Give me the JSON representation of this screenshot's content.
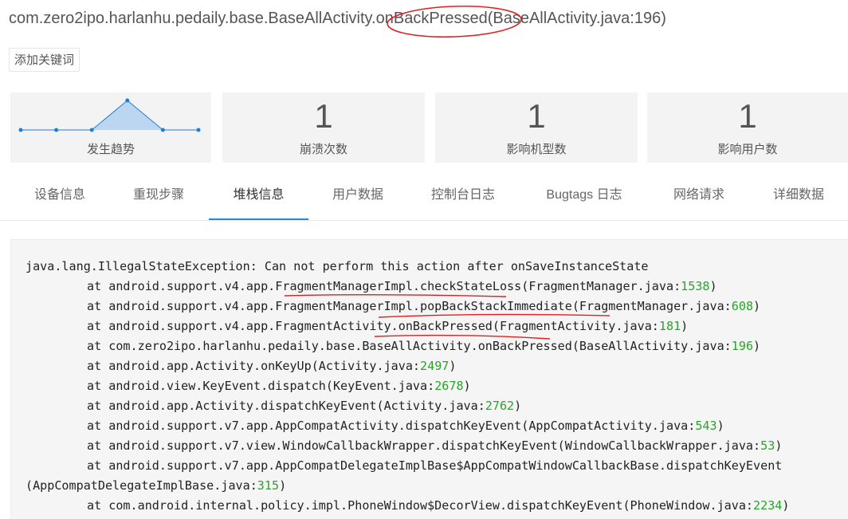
{
  "header": {
    "title": "com.zero2ipo.harlanhu.pedaily.base.BaseAllActivity.onBackPressed(BaseAllActivity.java:196)",
    "add_keyword_label": "添加关键词"
  },
  "stats": {
    "trend_label": "发生趋势",
    "trend_values": [
      0,
      0,
      0,
      1,
      0,
      0
    ],
    "crash_count": "1",
    "crash_count_label": "崩溃次数",
    "device_models": "1",
    "device_models_label": "影响机型数",
    "users": "1",
    "users_label": "影响用户数"
  },
  "tabs": [
    "设备信息",
    "重现步骤",
    "堆栈信息",
    "用户数据",
    "控制台日志",
    "Bugtags 日志",
    "网络请求",
    "详细数据"
  ],
  "active_tab": "堆栈信息",
  "stack": {
    "exception": "java.lang.IllegalStateException: Can not perform this action after onSaveInstanceState",
    "frames": [
      {
        "prefix": "at android.support.v4.app.FragmentManagerImpl.checkStateLoss(FragmentManager.java:",
        "line": "1538",
        "suffix": ")"
      },
      {
        "prefix": "at android.support.v4.app.FragmentManagerImpl.popBackStackImmediate(FragmentManager.java:",
        "line": "608",
        "suffix": ")"
      },
      {
        "prefix": "at android.support.v4.app.FragmentActivity.onBackPressed(FragmentActivity.java:",
        "line": "181",
        "suffix": ")"
      },
      {
        "prefix": "at com.zero2ipo.harlanhu.pedaily.base.BaseAllActivity.onBackPressed(BaseAllActivity.java:",
        "line": "196",
        "suffix": ")"
      },
      {
        "prefix": "at android.app.Activity.onKeyUp(Activity.java:",
        "line": "2497",
        "suffix": ")"
      },
      {
        "prefix": "at android.view.KeyEvent.dispatch(KeyEvent.java:",
        "line": "2678",
        "suffix": ")"
      },
      {
        "prefix": "at android.app.Activity.dispatchKeyEvent(Activity.java:",
        "line": "2762",
        "suffix": ")"
      },
      {
        "prefix": "at android.support.v7.app.AppCompatActivity.dispatchKeyEvent(AppCompatActivity.java:",
        "line": "543",
        "suffix": ")"
      },
      {
        "prefix": "at android.support.v7.view.WindowCallbackWrapper.dispatchKeyEvent(WindowCallbackWrapper.java:",
        "line": "53",
        "suffix": ")"
      },
      {
        "prefix": "at android.support.v7.app.AppCompatDelegateImplBase$AppCompatWindowCallbackBase.dispatchKeyEvent",
        "line": "",
        "suffix": ""
      },
      {
        "prefix": "(AppCompatDelegateImplBase.java:",
        "line": "315",
        "suffix": ")"
      },
      {
        "prefix": "at com.android.internal.policy.impl.PhoneWindow$DecorView.dispatchKeyEvent(PhoneWindow.java:",
        "line": "2234",
        "suffix": ")"
      }
    ]
  },
  "colors": {
    "accent": "#1e8ce0",
    "line_number": "#27a627",
    "annotation": "#e02020",
    "trend_fill": "#bcd6f2",
    "trend_line": "#1e7fd8"
  }
}
